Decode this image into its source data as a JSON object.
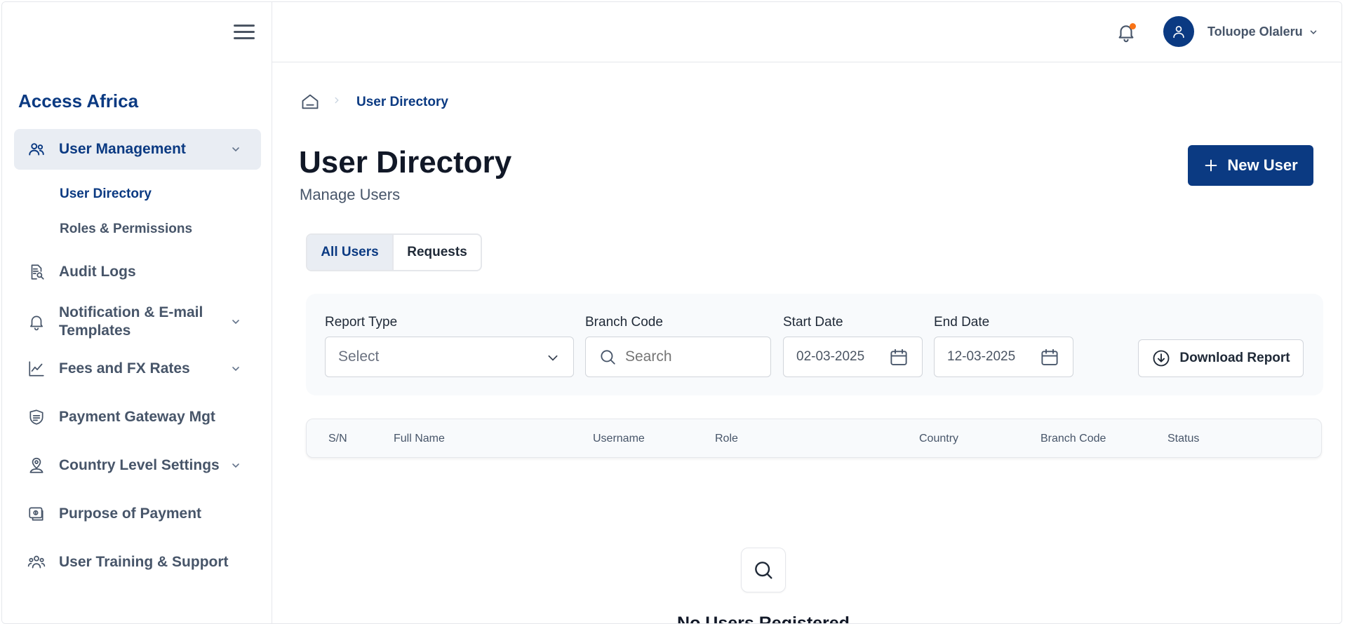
{
  "sidebar": {
    "brand": "Access Africa",
    "items": [
      {
        "label": "User Management",
        "icon": "users-icon"
      },
      {
        "label": "Audit Logs",
        "icon": "document-search-icon"
      },
      {
        "label": "Notification & E-mail Templates",
        "icon": "bell-icon"
      },
      {
        "label": "Fees and FX Rates",
        "icon": "chart-line-icon"
      },
      {
        "label": "Payment Gateway Mgt",
        "icon": "gateway-icon"
      },
      {
        "label": "Country Level Settings",
        "icon": "location-user-icon"
      },
      {
        "label": "Purpose of Payment",
        "icon": "payment-icon"
      },
      {
        "label": "User Training & Support",
        "icon": "support-users-icon"
      }
    ],
    "subitems": [
      {
        "label": "User Directory"
      },
      {
        "label": "Roles & Permissions"
      }
    ]
  },
  "header": {
    "user_name": "Toluope Olaleru"
  },
  "breadcrumb": {
    "current": "User Directory"
  },
  "main": {
    "title": "User Directory",
    "subtitle": "Manage Users",
    "new_user_label": "New User",
    "tabs": [
      {
        "label": "All Users"
      },
      {
        "label": "Requests"
      }
    ],
    "filters": {
      "report_type_label": "Report Type",
      "report_type_value": "Select",
      "branch_code_label": "Branch Code",
      "branch_code_placeholder": "Search",
      "start_date_label": "Start Date",
      "start_date_value": "02-03-2025",
      "end_date_label": "End Date",
      "end_date_value": "12-03-2025",
      "download_label": "Download Report"
    },
    "table": {
      "columns": [
        "S/N",
        "Full Name",
        "Username",
        "Role",
        "Country",
        "Branch Code",
        "Status"
      ]
    },
    "empty_state": {
      "title": "No Users Registered"
    }
  },
  "colors": {
    "brand": "#0b3a82",
    "notification_dot": "#f97316",
    "active_bg": "#e9edf3"
  }
}
